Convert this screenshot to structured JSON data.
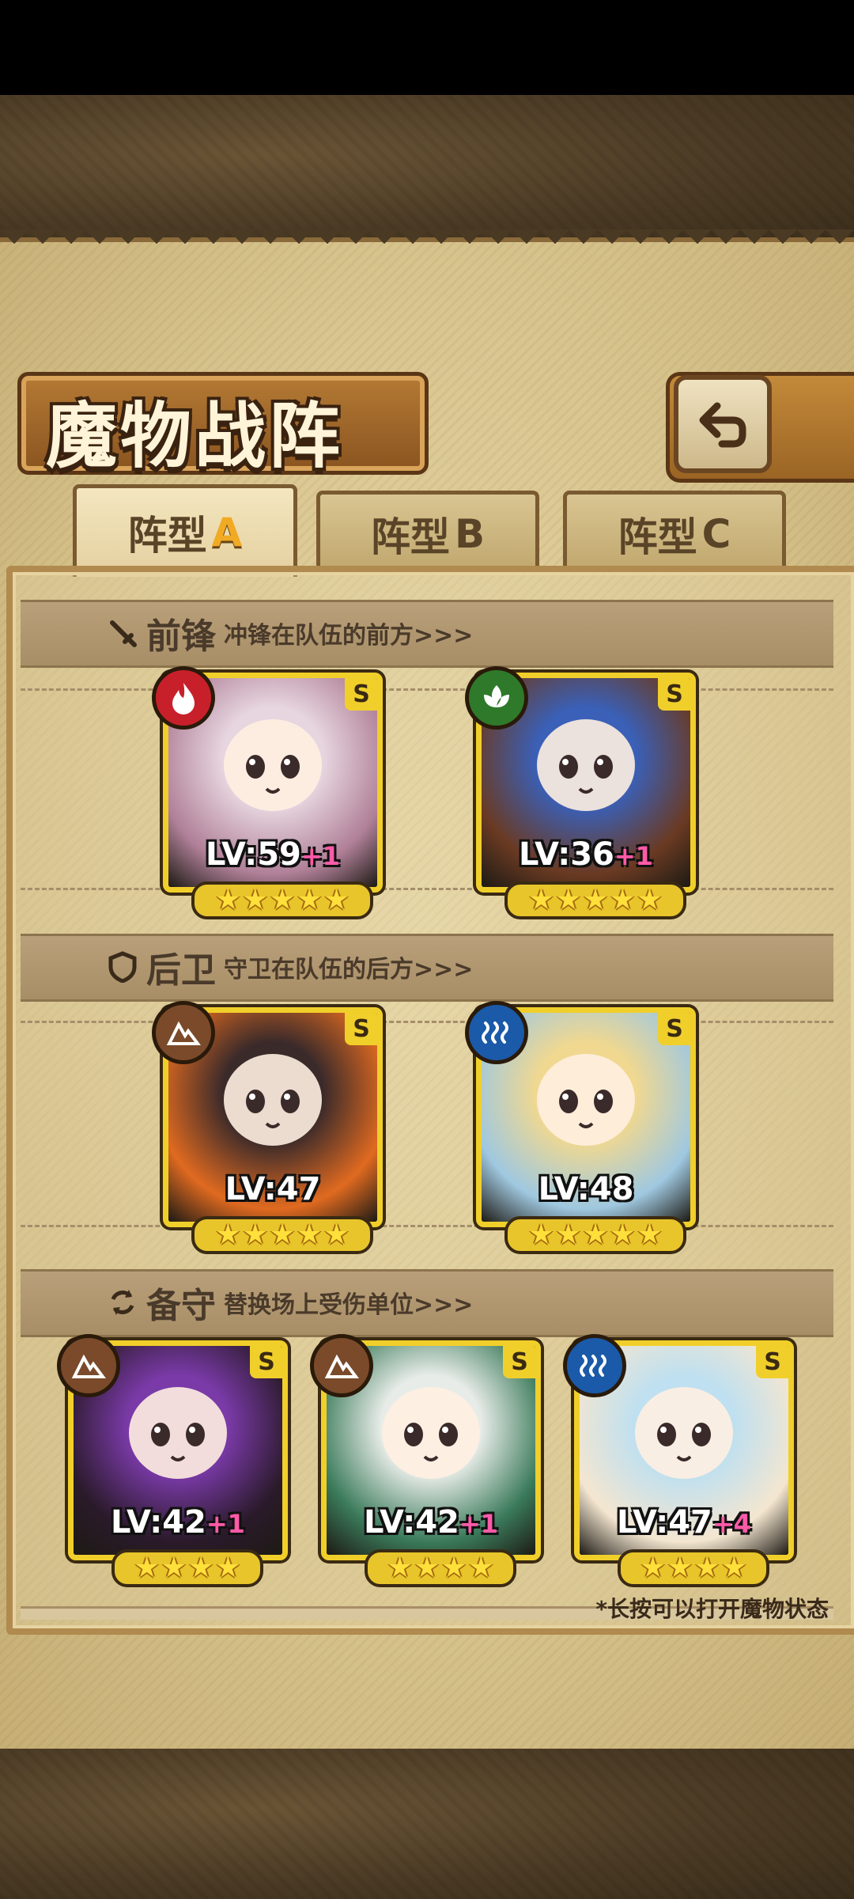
{
  "title": "魔物战阵",
  "tabs": [
    {
      "prefix": "阵型",
      "letter": "A",
      "active": true
    },
    {
      "prefix": "阵型",
      "letter": "B",
      "active": false
    },
    {
      "prefix": "阵型",
      "letter": "C",
      "active": false
    }
  ],
  "sections": {
    "front": {
      "title": "前锋",
      "desc": "冲锋在队伍的前方>>>",
      "icon": "sword-icon"
    },
    "rear": {
      "title": "后卫",
      "desc": "守卫在队伍的后方>>>",
      "icon": "shield-icon"
    },
    "reserve": {
      "title": "备守",
      "desc": "替换场上受伤单位>>>",
      "icon": "swap-icon"
    }
  },
  "units": {
    "front": [
      {
        "rank": "S",
        "element": "fire",
        "element_color": "#c8202a",
        "level": "LV:59",
        "bonus": "+1",
        "stars": 5,
        "palette": [
          "#e7d6e0",
          "#b08098"
        ]
      },
      {
        "rank": "S",
        "element": "wind",
        "element_color": "#2e7a2a",
        "level": "LV:36",
        "bonus": "+1",
        "stars": 5,
        "palette": [
          "#3a60b8",
          "#6a3a22"
        ]
      }
    ],
    "rear": [
      {
        "rank": "S",
        "element": "earth",
        "element_color": "#7a4a2a",
        "level": "LV:47",
        "bonus": "",
        "stars": 5,
        "palette": [
          "#3a2a2a",
          "#e06a20"
        ]
      },
      {
        "rank": "S",
        "element": "water",
        "element_color": "#1a5aa8",
        "level": "LV:48",
        "bonus": "",
        "stars": 5,
        "palette": [
          "#f0d890",
          "#9fc8e0"
        ]
      }
    ],
    "reserve": [
      {
        "rank": "S",
        "element": "earth",
        "element_color": "#7a4a2a",
        "level": "LV:42",
        "bonus": "+1",
        "stars": 4,
        "palette": [
          "#7a3aa8",
          "#2a1a2a"
        ]
      },
      {
        "rank": "S",
        "element": "earth",
        "element_color": "#7a4a2a",
        "level": "LV:42",
        "bonus": "+1",
        "stars": 4,
        "palette": [
          "#e8ece8",
          "#3a7a5a"
        ]
      },
      {
        "rank": "S",
        "element": "water",
        "element_color": "#1a5aa8",
        "level": "LV:47",
        "bonus": "+4",
        "stars": 4,
        "palette": [
          "#bfe0f0",
          "#f4e6d0"
        ]
      }
    ]
  },
  "hint": "*长按可以打开魔物状态",
  "colors": {
    "frame_gold": "#f1cf2a",
    "panel": "#e8d8a8",
    "plate": "#b47a34"
  }
}
